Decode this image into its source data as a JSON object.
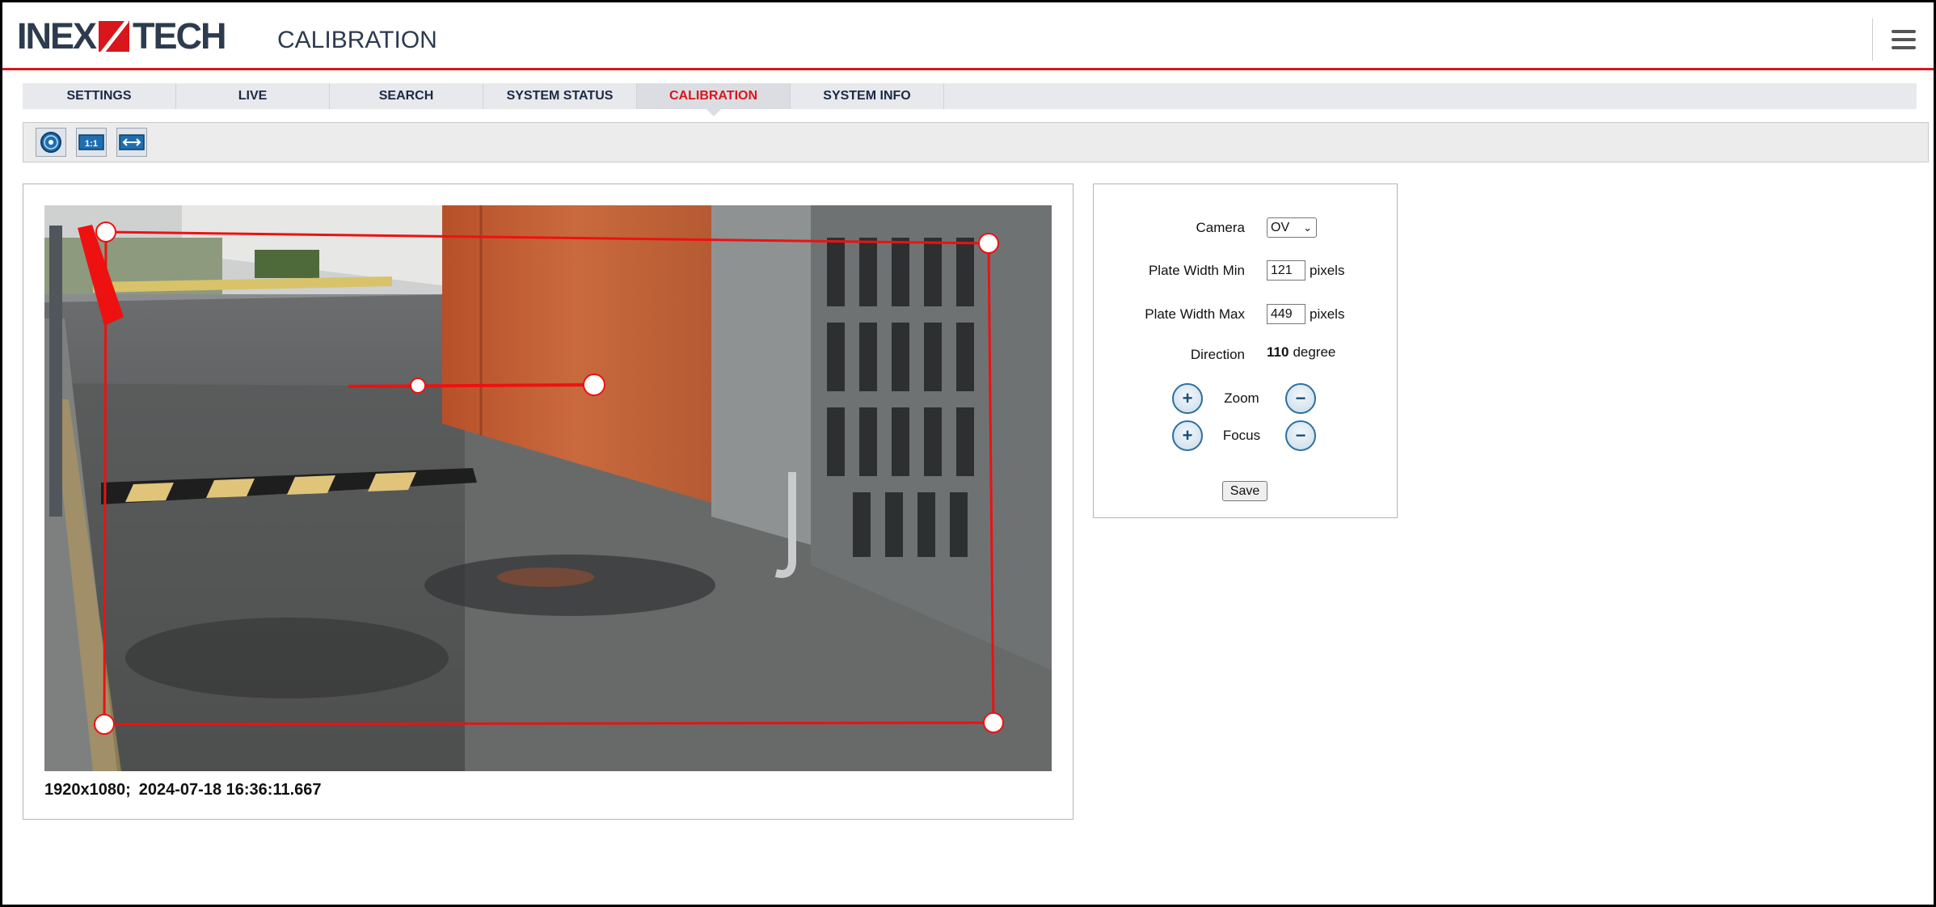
{
  "header": {
    "logo_left": "INEX",
    "logo_right": "TECH",
    "page_title": "CALIBRATION"
  },
  "tabs": [
    {
      "label": "SETTINGS",
      "active": false
    },
    {
      "label": "LIVE",
      "active": false
    },
    {
      "label": "SEARCH",
      "active": false
    },
    {
      "label": "SYSTEM STATUS",
      "active": false
    },
    {
      "label": "CALIBRATION",
      "active": true
    },
    {
      "label": "SYSTEM INFO",
      "active": false
    }
  ],
  "toolbar": {
    "tools": [
      "center-icon",
      "ratio-1-1-icon",
      "fit-width-icon"
    ],
    "ratio_label": "1:1"
  },
  "video": {
    "resolution": "1920x1080;",
    "timestamp": "2024-07-18 16:36:11.667"
  },
  "settings": {
    "camera_label": "Camera",
    "camera_value": "OV",
    "plate_min_label": "Plate Width Min",
    "plate_min_value": "121",
    "plate_max_label": "Plate Width Max",
    "plate_max_value": "449",
    "pixels_unit": "pixels",
    "direction_label": "Direction",
    "direction_value": "110",
    "direction_unit": "degree",
    "zoom_label": "Zoom",
    "focus_label": "Focus",
    "plus_symbol": "+",
    "minus_symbol": "−",
    "save_label": "Save"
  },
  "colors": {
    "accent_red": "#d9161c",
    "brand_navy": "#2d3b4e",
    "button_blue": "#2c6fa0"
  }
}
